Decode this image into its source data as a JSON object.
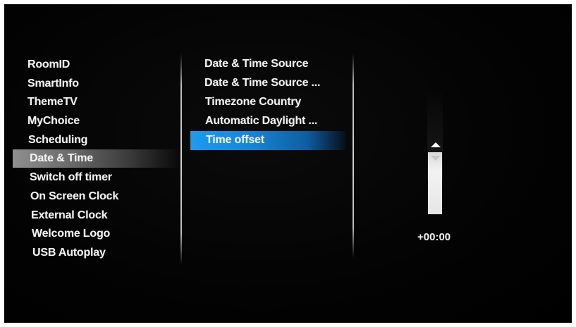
{
  "left_menu": {
    "items": [
      {
        "label": "RoomID"
      },
      {
        "label": "SmartInfo"
      },
      {
        "label": "ThemeTV"
      },
      {
        "label": "MyChoice"
      },
      {
        "label": "Scheduling"
      },
      {
        "label": "Date & Time",
        "selected": true
      },
      {
        "label": "Switch off timer"
      },
      {
        "label": "On Screen Clock"
      },
      {
        "label": "External Clock"
      },
      {
        "label": "Welcome Logo"
      },
      {
        "label": "USB Autoplay"
      }
    ]
  },
  "sub_menu": {
    "items": [
      {
        "label": "Date & Time Source"
      },
      {
        "label": "Date & Time Source ..."
      },
      {
        "label": "Timezone Country"
      },
      {
        "label": "Automatic Daylight ..."
      },
      {
        "label": "Time offset",
        "selected": true
      }
    ]
  },
  "time_offset_slider": {
    "value_text": "+00:00",
    "up_arrow_icon": "triangle-up-icon",
    "down_arrow_icon": "triangle-down-icon"
  },
  "colors": {
    "background": "#000000",
    "text": "#f2f2f2",
    "left_selection": "#8f8f8f",
    "sub_selection": "#1e9bf0"
  }
}
